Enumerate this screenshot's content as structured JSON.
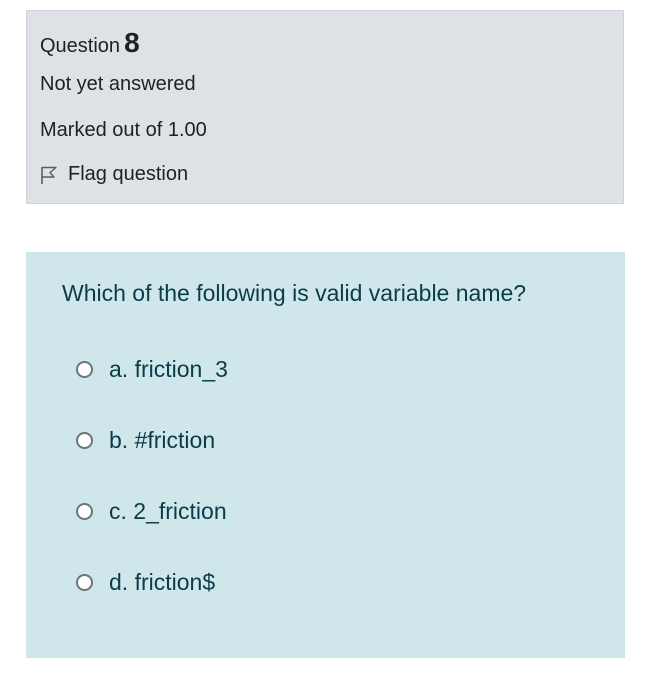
{
  "info": {
    "question_label": "Question",
    "question_number": "8",
    "state": "Not yet answered",
    "grade": "Marked out of 1.00",
    "flag_label": "Flag question",
    "flag_icon": "flag-icon"
  },
  "question": {
    "text": "Which of the following is valid variable name?",
    "answers": [
      {
        "label": "a. friction_3",
        "checked": false
      },
      {
        "label": "b. #friction",
        "checked": false
      },
      {
        "label": "c. 2_friction",
        "checked": false
      },
      {
        "label": "d. friction$",
        "checked": false
      }
    ]
  },
  "colors": {
    "info_background": "#dee2e6",
    "content_background": "#cfe6ea",
    "question_text": "#0b3c49"
  }
}
